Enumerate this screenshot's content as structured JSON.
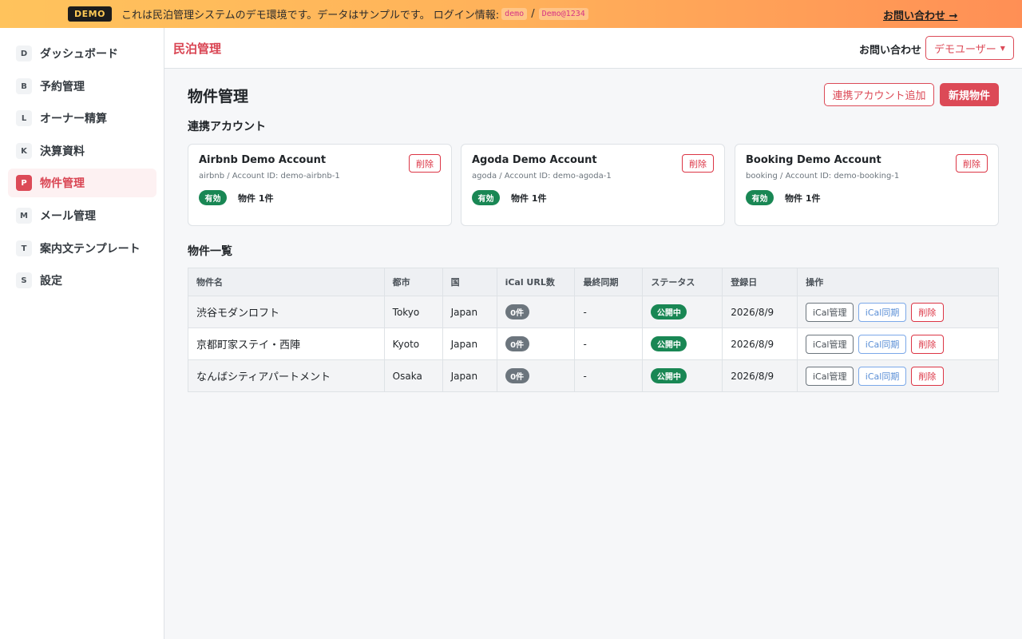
{
  "banner": {
    "badge": "DEMO",
    "message": "これは民泊管理システムのデモ環境です。データはサンプルです。 ログイン情報:",
    "login_user": "demo",
    "separator": "/",
    "login_pass": "Demo@1234",
    "contact_link": "お問い合わせ →",
    "colors": {
      "gradient_start": "#ffc35c",
      "gradient_end": "#ff8f55"
    }
  },
  "sidebar": {
    "items": [
      {
        "letter": "D",
        "label": "ダッシュボード"
      },
      {
        "letter": "B",
        "label": "予約管理"
      },
      {
        "letter": "L",
        "label": "オーナー精算"
      },
      {
        "letter": "K",
        "label": "決算資料"
      },
      {
        "letter": "P",
        "label": "物件管理",
        "active": true
      },
      {
        "letter": "M",
        "label": "メール管理"
      },
      {
        "letter": "T",
        "label": "案内文テンプレート"
      },
      {
        "letter": "S",
        "label": "設定"
      }
    ]
  },
  "header": {
    "brand": "民泊管理",
    "contact": "お問い合わせ",
    "user_menu": "デモユーザー",
    "accent_color": "#dc4a57"
  },
  "main": {
    "title": "物件管理",
    "add_account_button": "連携アカウント追加",
    "new_property_button": "新規物件",
    "accounts_section_title": "連携アカウント",
    "accounts": [
      {
        "name": "Airbnb Demo Account",
        "meta": "airbnb / Account ID: demo-airbnb-1",
        "status": "有効",
        "count": "物件 1件",
        "delete_label": "削除"
      },
      {
        "name": "Agoda Demo Account",
        "meta": "agoda / Account ID: demo-agoda-1",
        "status": "有効",
        "count": "物件 1件",
        "delete_label": "削除"
      },
      {
        "name": "Booking Demo Account",
        "meta": "booking / Account ID: demo-booking-1",
        "status": "有効",
        "count": "物件 1件",
        "delete_label": "削除"
      }
    ],
    "list_section_title": "物件一覧",
    "table": {
      "columns": [
        "物件名",
        "都市",
        "国",
        "iCal URL数",
        "最終同期",
        "ステータス",
        "登録日",
        "操作"
      ],
      "rows": [
        {
          "name": "渋谷モダンロフト",
          "city": "Tokyo",
          "country": "Japan",
          "ical_count": "0件",
          "last_sync": "-",
          "status": "公開中",
          "registered": "2026/8/9"
        },
        {
          "name": "京都町家ステイ・西陣",
          "city": "Kyoto",
          "country": "Japan",
          "ical_count": "0件",
          "last_sync": "-",
          "status": "公開中",
          "registered": "2026/8/9"
        },
        {
          "name": "なんばシティアパートメント",
          "city": "Osaka",
          "country": "Japan",
          "ical_count": "0件",
          "last_sync": "-",
          "status": "公開中",
          "registered": "2026/8/9"
        }
      ],
      "actions": {
        "ical_manage": "iCal管理",
        "ical_sync": "iCal同期",
        "delete": "削除"
      }
    },
    "status_colors": {
      "active": "#198754",
      "count_pill": "#6c757d",
      "danger": "#dc3545"
    }
  }
}
